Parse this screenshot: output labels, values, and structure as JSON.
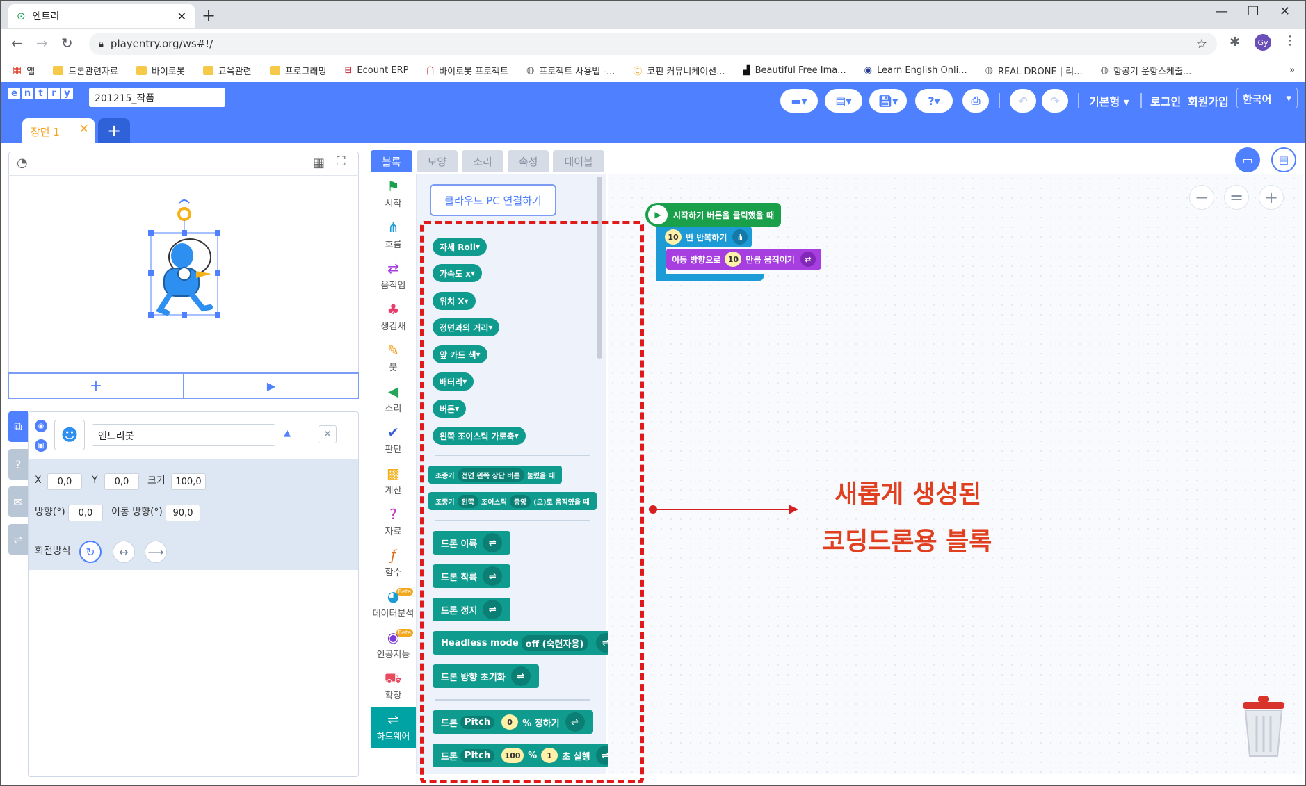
{
  "browser": {
    "tab_title": "엔트리",
    "url": "playentry.org/ws#!/",
    "bookmarks": [
      "앱",
      "드론관련자료",
      "바이로봇",
      "교육관련",
      "프로그래밍",
      "Ecount ERP",
      "바이로봇 프로젝트",
      "프로젝트 사용법 -...",
      "코핀 커뮤니케이션...",
      "Beautiful Free Ima...",
      "Learn English Onli...",
      "REAL DRONE | 리...",
      "항공기 운항스케줄..."
    ],
    "profile": "Gy"
  },
  "header": {
    "logo": [
      "e",
      "n",
      "t",
      "r",
      "y"
    ],
    "project_name": "201215_작품",
    "mode_label": "기본형",
    "login_label": "로그인",
    "signup_label": "회원가입",
    "language": "한국어",
    "accent": "#4f80ff"
  },
  "scene": {
    "tab_label": "장면 1"
  },
  "object": {
    "name": "엔트리봇",
    "x_label": "X",
    "x_value": "0,0",
    "y_label": "Y",
    "y_value": "0,0",
    "size_label": "크기",
    "size_value": "100,0",
    "direction_label": "방향(°)",
    "direction_value": "0,0",
    "move_direction_label": "이동 방향(°)",
    "move_direction_value": "90,0",
    "rotation_label": "회전방식"
  },
  "block_tabs": [
    "블록",
    "모양",
    "소리",
    "속성",
    "테이블"
  ],
  "categories": [
    {
      "label": "시작",
      "icon": "flag-icon"
    },
    {
      "label": "흐름",
      "icon": "flow-icon"
    },
    {
      "label": "움직임",
      "icon": "move-icon"
    },
    {
      "label": "생김새",
      "icon": "looks-icon"
    },
    {
      "label": "붓",
      "icon": "brush-icon"
    },
    {
      "label": "소리",
      "icon": "sound-icon"
    },
    {
      "label": "판단",
      "icon": "judge-icon"
    },
    {
      "label": "계산",
      "icon": "calc-icon"
    },
    {
      "label": "자료",
      "icon": "data-icon"
    },
    {
      "label": "함수",
      "icon": "function-icon"
    },
    {
      "label": "데이터분석",
      "icon": "analysis-icon"
    },
    {
      "label": "인공지능",
      "icon": "ai-icon"
    },
    {
      "label": "확장",
      "icon": "extension-icon"
    },
    {
      "label": "하드웨어",
      "icon": "hardware-icon"
    }
  ],
  "beta_label": "Beta",
  "palette": {
    "cloud_button": "클라우드 PC 연결하기",
    "sensor_blocks": [
      "자세 Roll",
      "가속도 x",
      "위치 X",
      "정면과의 거리",
      "앞 카드 색",
      "배터리",
      "버튼",
      "왼쪽 조이스틱 가로축"
    ],
    "event_block_1": {
      "prefix": "조종기",
      "dropdown": "전면 왼쪽 상단 버튼",
      "suffix": "눌렀을 때"
    },
    "event_block_2": {
      "prefix": "조종기",
      "dd1": "왼쪽",
      "mid": "조이스틱",
      "dd2": "중앙",
      "suffix": "(으)로 움직였을 때"
    },
    "takeoff": "드론 이륙",
    "landing": "드론 착륙",
    "stop": "드론 정지",
    "headless_label": "Headless mode",
    "headless_value": "off (숙련자용)",
    "reset_heading": "드론 방향 초기화",
    "pitch1": {
      "prefix": "드론",
      "dd": "Pitch",
      "value": "0",
      "suffix": "% 정하기"
    },
    "pitch2": {
      "prefix": "드론",
      "dd": "Pitch",
      "value1": "100",
      "pct": "%",
      "value2": "1",
      "suffix": "초 실행"
    }
  },
  "script": {
    "start_block": "시작하기 버튼을 클릭했을 때",
    "repeat_count": "10",
    "repeat_label": "번 반복하기",
    "move_label": "이동 방향으로",
    "move_value": "10",
    "move_suffix": "만큼 움직이기"
  },
  "annotation": {
    "line1": "새롭게 생성된",
    "line2": "코딩드론용 블록",
    "color": "#e04020"
  }
}
